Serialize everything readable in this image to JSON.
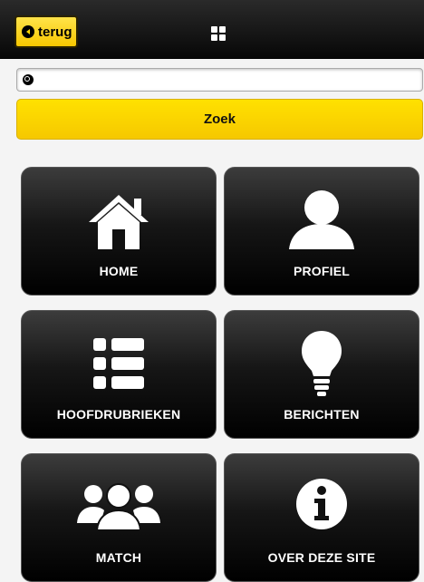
{
  "header": {
    "back_label": "terug",
    "back_icon": "chevron-left-circle-icon",
    "menu_icon": "grid-icon"
  },
  "search": {
    "value": "",
    "placeholder": "",
    "icon": "search-icon",
    "button_label": "Zoek"
  },
  "tiles": [
    {
      "label": "HOME",
      "icon": "home-icon"
    },
    {
      "label": "PROFIEL",
      "icon": "user-icon"
    },
    {
      "label": "HOOFDRUBRIEKEN",
      "icon": "list-icon"
    },
    {
      "label": "BERICHTEN",
      "icon": "lightbulb-icon"
    },
    {
      "label": "MATCH",
      "icon": "users-icon"
    },
    {
      "label": "OVER DEZE SITE",
      "icon": "info-icon"
    }
  ],
  "colors": {
    "accent": "#ffd700",
    "header": "#111111",
    "tile": "#1a1a1a"
  }
}
